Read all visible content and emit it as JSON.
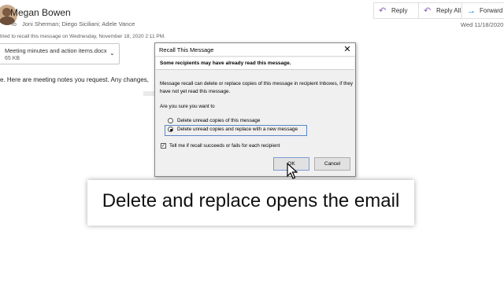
{
  "email": {
    "sender": "Megan Bowen",
    "to_label": "To",
    "recipients": "Joni Sherman; Diego Siciliani; Adele Vance",
    "date": "Wed 11/18/2020",
    "recall_info": "tried to recall this message on Wednesday, November 18, 2020 2:11 PM.",
    "body_text": "e. Here are meeting notes you request. Any changes,"
  },
  "actions": {
    "reply": "Reply",
    "reply_all": "Reply All",
    "forward": "Forward"
  },
  "attachment": {
    "name": "Meeting minutes and action items.docx",
    "size": "65 KB"
  },
  "dialog": {
    "title": "Recall This Message",
    "warning": "Some recipients may have already read this message.",
    "description": "Message recall can delete or replace copies of this message in recipient Inboxes, if they have not yet read this message.",
    "question": "Are you sure you want to",
    "option_delete": "Delete unread copies of this message",
    "option_replace": "Delete unread copies and replace with a new message",
    "selected_option": "option_replace",
    "checkbox_label": "Tell me if recall succeeds or fails for each recipient",
    "checkbox_checked": true,
    "ok_label": "OK",
    "cancel_label": "Cancel"
  },
  "caption": "Delete and replace opens the email"
}
